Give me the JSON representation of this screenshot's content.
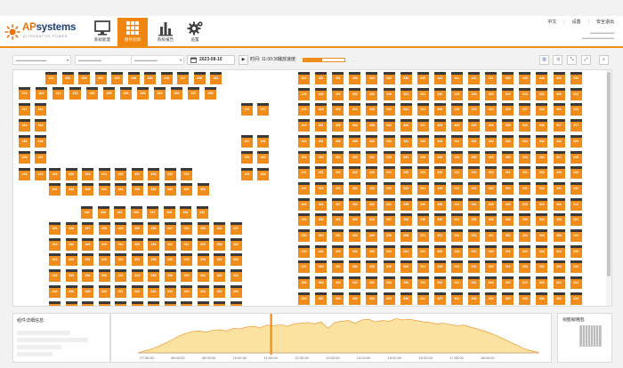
{
  "header": {
    "logo": {
      "name_a": "AP",
      "name_b": "systems",
      "sub": "ALTERNATIVE POWER"
    },
    "nav": [
      {
        "label": "系统能量",
        "icon": "monitor-icon"
      },
      {
        "label": "组件功率",
        "icon": "grid-icon"
      },
      {
        "label": "系统报告",
        "icon": "bar-chart-icon"
      },
      {
        "label": "设置",
        "icon": "gear-icon"
      }
    ],
    "top_links": [
      "中文",
      "设置",
      "安全退出"
    ]
  },
  "toolbar": {
    "date": "2023-08-10",
    "time_label": "时间:",
    "time_value": "11:00:36",
    "speed_label": "播放速度:",
    "speed_level": 0.45,
    "btn_icons": [
      "play-icon",
      "chart-toggle-icon",
      "shuffle-icon",
      "compress-icon",
      "expand-icon",
      "search-icon"
    ]
  },
  "array": {
    "left_groups": [
      {
        "rows": [
          [
            "323",
            "333",
            "333",
            "331",
            "329",
            "338",
            "328",
            "316",
            "317",
            "338",
            "331"
          ],
          [
            "324",
            "322",
            "313",
            "313",
            "330",
            "325",
            "328",
            "325",
            "333",
            "320",
            "337",
            "330"
          ],
          [
            "327",
            "332",
            "",
            "",
            "",
            "",
            "",
            "",
            "",
            "",
            "331",
            "337"
          ],
          [
            "324",
            "322",
            "",
            "",
            "",
            "",
            "",
            "",
            "",
            "",
            "",
            ""
          ],
          [
            "326",
            "328",
            "",
            "",
            "",
            "",
            "",
            "",
            "",
            "",
            "337",
            "336"
          ],
          [
            "326",
            "331",
            "",
            "",
            "",
            "",
            "",
            "",
            "",
            "",
            "326",
            "332"
          ],
          [
            "325",
            "326",
            "340",
            "333",
            "333",
            "331",
            "330",
            "332",
            "333",
            "333",
            "333",
            "326",
            "335"
          ],
          [
            "",
            "",
            "341",
            "333",
            "328",
            "332",
            "332",
            "330",
            "332",
            "333",
            "330",
            "330",
            ""
          ]
        ]
      }
    ],
    "left_lower": [
      [
        "333",
        "333",
        "331",
        "330",
        "337",
        "333",
        "332",
        "333"
      ],
      [
        "326",
        "333",
        "327",
        "335",
        "329",
        "330",
        "326",
        "327",
        "330",
        "330",
        "331",
        "337"
      ],
      [
        "333",
        "332",
        "342",
        "340",
        "332",
        "336",
        "332",
        "322",
        "331",
        "333",
        "338",
        "332"
      ],
      [
        "333",
        "333",
        "331",
        "330",
        "333",
        "332",
        "338",
        "335",
        "328",
        "333",
        "332",
        "332"
      ],
      [
        "333",
        "333",
        "332",
        "336",
        "333",
        "324",
        "335",
        "336",
        "330",
        "331",
        "333",
        "331"
      ],
      [
        "332",
        "330",
        "328",
        "332",
        "331",
        "332",
        "331",
        "333",
        "329",
        "322",
        "331",
        "333"
      ],
      [
        "333",
        "331",
        "326",
        "329",
        "333",
        "330",
        "333",
        "332",
        "333",
        "331",
        "325",
        "339"
      ],
      [
        "333",
        "331",
        "339",
        "337",
        "335",
        "330",
        "336",
        "332",
        "330",
        "330",
        "331",
        "336"
      ]
    ],
    "right": [
      [
        "322",
        "331",
        "331",
        "333",
        "330",
        "332",
        "330",
        "329",
        "341",
        "331",
        "321",
        "321",
        "329",
        "330",
        "340",
        "332",
        "333"
      ],
      [
        "329",
        "332",
        "333",
        "332",
        "330",
        "326",
        "331",
        "332",
        "326",
        "335",
        "333",
        "335",
        "324",
        "333",
        "331",
        "332",
        "323"
      ],
      [
        "329",
        "323",
        "332",
        "341",
        "333",
        "332",
        "331",
        "333",
        "336",
        "330",
        "333",
        "329",
        "329",
        "327",
        "333",
        "331",
        "323"
      ],
      [
        "329",
        "331",
        "330",
        "332",
        "333",
        "322",
        "332",
        "331",
        "333",
        "330",
        "332",
        "333",
        "335",
        "332",
        "333",
        "317",
        "317"
      ],
      [
        "330",
        "331",
        "330",
        "335",
        "333",
        "333",
        "331",
        "333",
        "333",
        "332",
        "331",
        "330",
        "333",
        "333",
        "332",
        "342",
        "333"
      ],
      [
        "332",
        "333",
        "331",
        "330",
        "331",
        "335",
        "331",
        "338",
        "333",
        "333",
        "330",
        "333",
        "330",
        "333",
        "331",
        "337",
        "328"
      ],
      [
        "331",
        "331",
        "333",
        "326",
        "330",
        "331",
        "330",
        "333",
        "326",
        "333",
        "331",
        "330",
        "331",
        "331",
        "332",
        "333",
        "328"
      ],
      [
        "331",
        "321",
        "332",
        "331",
        "333",
        "333",
        "333",
        "331",
        "333",
        "333",
        "331",
        "330",
        "333",
        "331",
        "332",
        "331",
        "332"
      ],
      [
        "325",
        "331",
        "337",
        "333",
        "332",
        "331",
        "335",
        "330",
        "330",
        "333",
        "331",
        "333",
        "333",
        "333",
        "333",
        "322",
        "313"
      ],
      [
        "333",
        "333",
        "331",
        "330",
        "328",
        "337",
        "333",
        "330",
        "330",
        "331",
        "330",
        "335",
        "333",
        "330",
        "333",
        "333",
        "331"
      ],
      [
        "330",
        "333",
        "331",
        "332",
        "330",
        "326",
        "335",
        "331",
        "331",
        "334",
        "331",
        "321",
        "331",
        "323",
        "330",
        "330",
        "331"
      ],
      [
        "333",
        "331",
        "333",
        "331",
        "331",
        "333",
        "331",
        "331",
        "330",
        "338",
        "331",
        "330",
        "331",
        "332",
        "333",
        "322",
        "335"
      ],
      [
        "331",
        "333",
        "331",
        "331",
        "333",
        "336",
        "332",
        "331",
        "333",
        "333",
        "331",
        "332",
        "331",
        "330",
        "331",
        "333",
        "332"
      ],
      [
        "328",
        "334",
        "332",
        "333",
        "331",
        "333",
        "330",
        "333",
        "332",
        "331",
        "331",
        "334",
        "330",
        "322",
        "332",
        "324",
        "334"
      ],
      [
        "324",
        "331",
        "334",
        "330",
        "330",
        "323",
        "330",
        "331",
        "337",
        "331",
        "332",
        "326",
        "320",
        "330",
        "332",
        "331",
        "324"
      ]
    ]
  },
  "info": {
    "title": "组件详细信息:"
  },
  "chart_data": {
    "type": "area",
    "x_labels": [
      "07:00:00",
      "08:00:00",
      "09:00:00",
      "10:00:00",
      "11:00:00",
      "12:00:00",
      "13:00:00",
      "14:00:00",
      "15:00:00",
      "16:00:00",
      "17:00:00",
      "18:00:00"
    ],
    "current_time": "11:00:36",
    "fill_color": "#fbe2a0",
    "line_color": "#f08c1a",
    "values": [
      0,
      3,
      6,
      10,
      15,
      20,
      26,
      30,
      33,
      34,
      32,
      35,
      36,
      34,
      38,
      37,
      40,
      41,
      39,
      43,
      42,
      44,
      41,
      45,
      46,
      47,
      45,
      48,
      38,
      47,
      49,
      50,
      46,
      51,
      52,
      48,
      50,
      49,
      53,
      51,
      52,
      50,
      48,
      47,
      45,
      46,
      44,
      42,
      43,
      40,
      37,
      34,
      30,
      26,
      21,
      16,
      11,
      6,
      3,
      1
    ]
  },
  "thumbnail": {
    "title": "视图缩略图:"
  }
}
